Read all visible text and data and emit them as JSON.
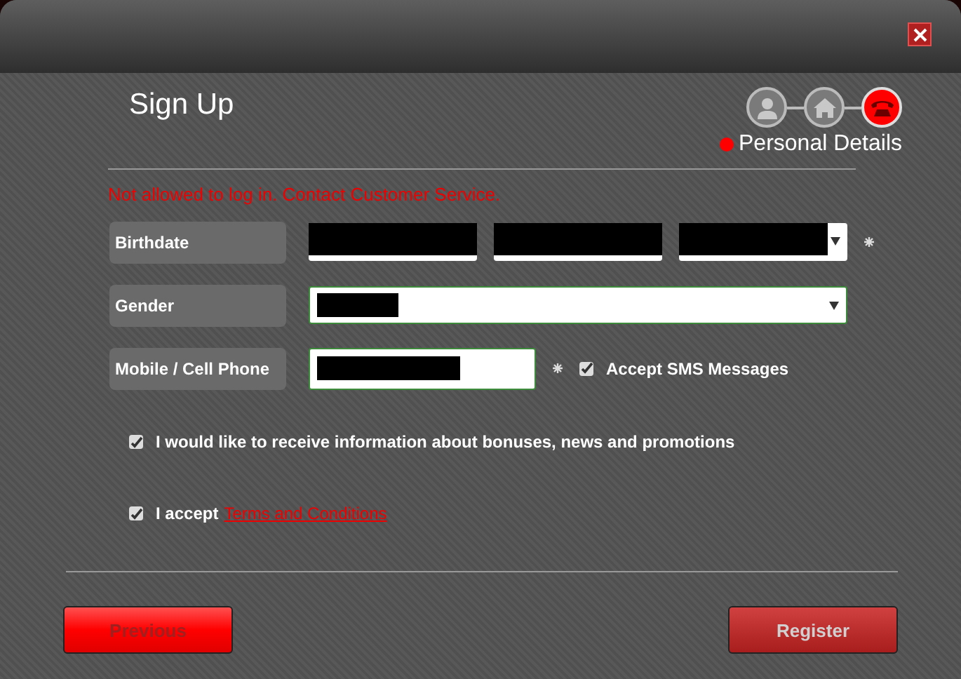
{
  "dialog": {
    "title": "Sign Up"
  },
  "steps": [
    {
      "selected": false
    },
    {
      "selected": false
    },
    {
      "selected": true
    }
  ],
  "current_step": "Personal Details",
  "error": "Not allowed to log in. Contact Customer Service.",
  "fields": [
    {
      "label": "Birthdate",
      "kind": "date",
      "required": true
    },
    {
      "label": "Gender",
      "kind": "select",
      "required": false
    },
    {
      "label": "Mobile / Cell Phone",
      "kind": "phone",
      "required": true
    }
  ],
  "sms": {
    "label": "Accept SMS Messages",
    "checked": true
  },
  "promotions": {
    "label": "I would like to receive information about bonuses, news and promotions",
    "checked": true
  },
  "terms": {
    "label": "I accept",
    "link": "Terms and Conditions",
    "checked": true
  },
  "buttons": [
    {
      "label": "Previous",
      "kind": "previous"
    },
    {
      "label": "Register",
      "kind": "register"
    }
  ]
}
